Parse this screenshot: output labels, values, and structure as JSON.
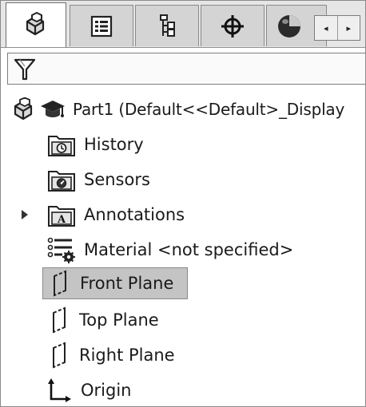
{
  "tabs": [
    {
      "name": "feature-manager-tab",
      "icon": "part-cube-icon",
      "active": true
    },
    {
      "name": "property-manager-tab",
      "icon": "property-list-icon",
      "active": false
    },
    {
      "name": "configuration-manager-tab",
      "icon": "configuration-tree-icon",
      "active": false
    },
    {
      "name": "dimxpert-manager-tab",
      "icon": "crosshair-target-icon",
      "active": false
    },
    {
      "name": "display-manager-tab",
      "icon": "appearance-sphere-icon",
      "active": false
    }
  ],
  "scroll": {
    "left_glyph": "◂",
    "right_glyph": "▸"
  },
  "filter": {
    "icon": "funnel-filter-icon"
  },
  "tree": {
    "root_label": "Part1  (Default<<Default>_Display",
    "items": [
      {
        "label": "History",
        "icon": "history-folder-icon"
      },
      {
        "label": "Sensors",
        "icon": "sensors-folder-icon"
      },
      {
        "label": "Annotations",
        "icon": "annotations-folder-icon",
        "expandable": true
      },
      {
        "label": "Material <not specified>",
        "icon": "material-icon"
      },
      {
        "label": "Front Plane",
        "icon": "plane-icon",
        "selected": true
      },
      {
        "label": "Top Plane",
        "icon": "plane-icon"
      },
      {
        "label": "Right Plane",
        "icon": "plane-icon"
      },
      {
        "label": "Origin",
        "icon": "origin-icon"
      }
    ]
  }
}
